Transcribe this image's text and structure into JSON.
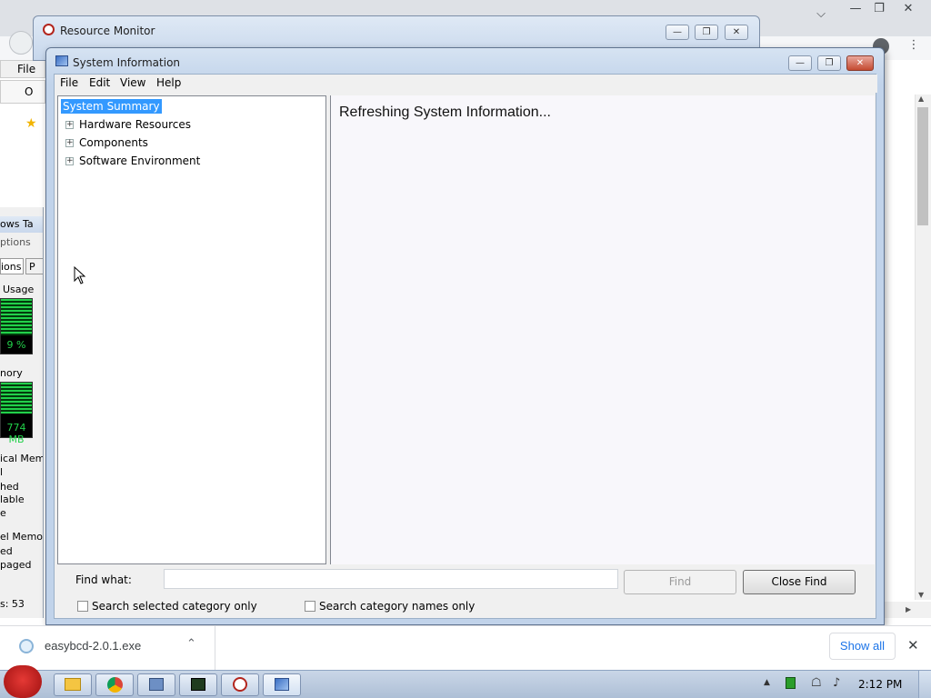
{
  "resource_monitor": {
    "title": "Resource Monitor"
  },
  "chrome": {
    "menu_frag": "File",
    "bookmark_frag": "O"
  },
  "task_manager": {
    "title_frag": "ows Ta",
    "menu_frag": "ptions",
    "tab_frag": "ions",
    "tab_frag2": "P",
    "cpu_header": "Usage",
    "cpu_value": "9 %",
    "cpu_level": 0.09,
    "memory_header": "nory",
    "memory_value": "774 MB",
    "physical_mem": [
      "ical Mem",
      "l",
      "hed",
      "lable",
      "e"
    ],
    "kernel_mem": [
      "el Memo",
      "ed",
      "paged"
    ],
    "processes": "s: 53"
  },
  "sysinfo": {
    "title": "System Information",
    "menus": [
      "File",
      "Edit",
      "View",
      "Help"
    ],
    "tree": {
      "root": "System Summary",
      "children": [
        "Hardware Resources",
        "Components",
        "Software Environment"
      ]
    },
    "details_text": "Refreshing System Information...",
    "find_label": "Find what:",
    "find_value": "",
    "find_button": "Find",
    "close_find_button": "Close Find",
    "check_selected": "Search selected category only",
    "check_names": "Search category names only"
  },
  "downloads": {
    "file": "easybcd-2.0.1.exe",
    "show_all": "Show all"
  },
  "taskbar": {
    "clock": "2:12 PM"
  },
  "colors": {
    "selection": "#3399ff",
    "link": "#1a73e8",
    "graph_green": "#22d14a"
  }
}
